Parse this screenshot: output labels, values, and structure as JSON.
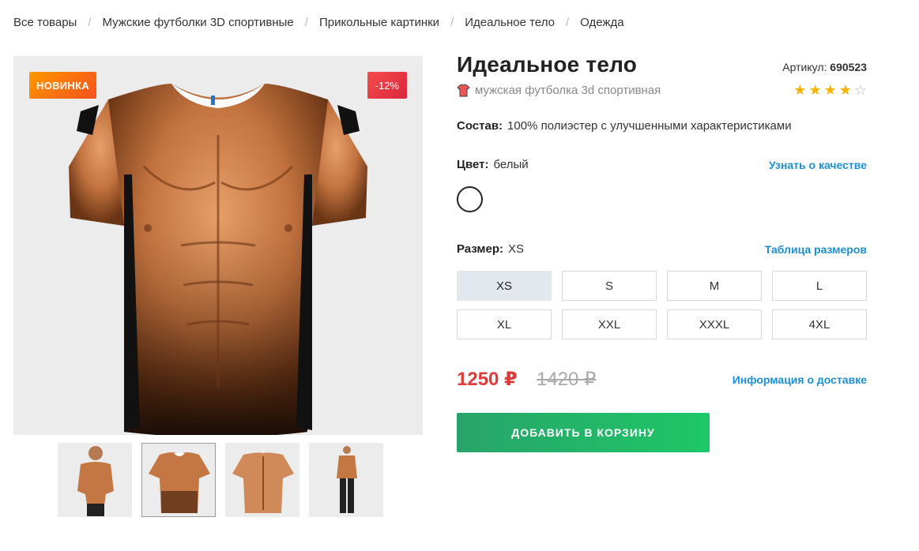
{
  "breadcrumbs": [
    {
      "label": "Все товары"
    },
    {
      "label": "Мужские футболки 3D спортивные"
    },
    {
      "label": "Прикольные картинки"
    },
    {
      "label": "Идеальное тело"
    },
    {
      "label": "Одежда"
    }
  ],
  "badges": {
    "new": "НОВИНКА",
    "discount": "-12%"
  },
  "product": {
    "title": "Идеальное тело",
    "article_label": "Артикул:",
    "article_value": "690523",
    "subtitle": "мужская футболка 3d спортивная",
    "rating": 4,
    "rating_max": 5
  },
  "composition": {
    "label": "Состав:",
    "value": "100% полиэстер с улучшенными характеристиками"
  },
  "color": {
    "label": "Цвет:",
    "value": "белый",
    "quality_link": "Узнать о качестве",
    "swatch_color": "#ffffff"
  },
  "size": {
    "label": "Размер:",
    "value": "XS",
    "table_link": "Таблица размеров",
    "options": [
      "XS",
      "S",
      "M",
      "L",
      "XL",
      "XXL",
      "XXXL",
      "4XL"
    ],
    "selected": "XS"
  },
  "pricing": {
    "price": "1250 ₽",
    "old_price": "1420 ₽",
    "delivery_link": "Информация о доставке"
  },
  "cart": {
    "add_label": "ДОБАВИТЬ В КОРЗИНУ"
  },
  "colors": {
    "accent_link": "#1b8fd3",
    "price_red": "#e03b3b",
    "cart_green": "#1ec767",
    "star": "#f5b301"
  },
  "thumbnails": [
    {
      "name": "model-front"
    },
    {
      "name": "shirt-front"
    },
    {
      "name": "shirt-back"
    },
    {
      "name": "model-full"
    }
  ]
}
